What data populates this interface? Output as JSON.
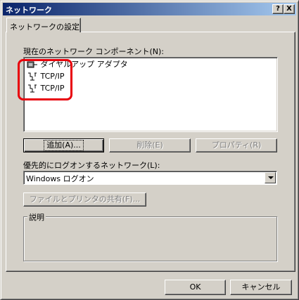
{
  "window": {
    "title": "ネットワーク",
    "help_btn": "?",
    "close_btn": "X"
  },
  "tab": {
    "label": "ネットワークの設定"
  },
  "components": {
    "label": "現在のネットワーク コンポーネント(N):",
    "items": [
      {
        "label": "ダイヤルアップ アダプタ",
        "icon": "adapter-icon"
      },
      {
        "label": "TCP/IP",
        "icon": "protocol-icon"
      },
      {
        "label": "TCP/IP",
        "icon": "protocol-icon"
      }
    ],
    "highlight_color": "#e8000b"
  },
  "buttons": {
    "add": "追加(A)...",
    "remove": "削除(E)",
    "properties": "プロパティ(R)"
  },
  "logon": {
    "label": "優先的にログオンするネットワーク(L):",
    "value": "Windows ログオン"
  },
  "file_sharing": {
    "label": "ファイルとプリンタの共有(F)..."
  },
  "description": {
    "label": "説明"
  },
  "footer": {
    "ok": "OK",
    "cancel": "キャンセル"
  }
}
